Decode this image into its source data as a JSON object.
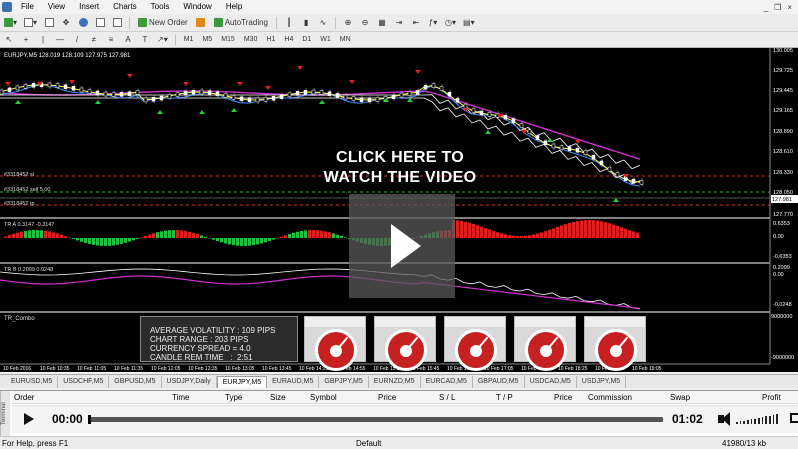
{
  "menu": [
    "File",
    "View",
    "Insert",
    "Charts",
    "Tools",
    "Window",
    "Help"
  ],
  "window_controls": [
    "_",
    "❐",
    "×"
  ],
  "toolbar": {
    "new_order": "New Order",
    "autotrading": "AutoTrading"
  },
  "timeframes": [
    "M1",
    "M5",
    "M15",
    "M30",
    "H1",
    "H4",
    "D1",
    "W1",
    "MN"
  ],
  "chart": {
    "header": "EURJPY,M5  128.019 128.109 127.975 127.981",
    "price_labels": [
      "130.005",
      "129.725",
      "129.445",
      "129.165",
      "128.890",
      "128.610",
      "128.330",
      "128.050",
      "127.981",
      "127.770"
    ],
    "order_lines": [
      "#3318452 sl",
      "#3318452 sell 5.00",
      "#3318452 tp"
    ],
    "tr_label": "TR A 0.3147 -0.3147",
    "tr_scale": [
      "0.6353",
      "0.00",
      "-0.6353"
    ],
    "tr2_label": "TR B 0.2099 0.0248",
    "tr2_scale": [
      "0.2099",
      "0.00",
      "-0.0248"
    ],
    "combo_label": "TR_Combo",
    "combo_scale": [
      "9000000",
      "-9000000"
    ],
    "time_labels": [
      "10 Feb 2016",
      "10 Feb 10:35",
      "10 Feb 11:05",
      "10 Feb 11:35",
      "10 Feb 12:05",
      "10 Feb 12:35",
      "10 Feb 13:05",
      "10 Feb 13:45",
      "10 Feb 14:25",
      "10 Feb 14:55",
      "10 Feb 15:25",
      "10 Feb 15:45",
      "10 Feb 16:25",
      "10 Feb 17:05",
      "10 Feb 17:45",
      "10 Feb 18:25",
      "10 Feb 18:55",
      "10 Feb 19:05"
    ],
    "overlay_text_1": "CLICK HERE TO",
    "overlay_text_2": "WATCH THE VIDEO",
    "stats": [
      "AVERAGE VOLATILITY : 109 PIPS",
      "CHART RANGE : 203 PIPS",
      "CURRENCY SPREAD = 4.0",
      "CANDLE REM TIME   :  2:51"
    ]
  },
  "symbol_tabs": [
    "EURUSD,M5",
    "USDCHF,M5",
    "GBPUSD,M5",
    "USDJPY,Daily",
    "EURJPY,M5",
    "EURAUD,M5",
    "GBPJPY,M5",
    "EURNZD,M5",
    "EURCAD,M5",
    "GBPAUD,M5",
    "USDCAD,M5",
    "USDJPY,M5"
  ],
  "active_tab": "EURJPY,M5",
  "terminal": {
    "side_label": "Terminal",
    "columns": [
      "Order",
      "Time",
      "Type",
      "Size",
      "Symbol",
      "Price",
      "S / L",
      "T / P",
      "Price",
      "Commission",
      "Swap",
      "Profit"
    ]
  },
  "player": {
    "current": "00:00",
    "total": "01:02",
    "progress": 0.0
  },
  "status": {
    "help": "For Help, press F1",
    "profile": "Default",
    "traffic": "41980/13 kb"
  }
}
